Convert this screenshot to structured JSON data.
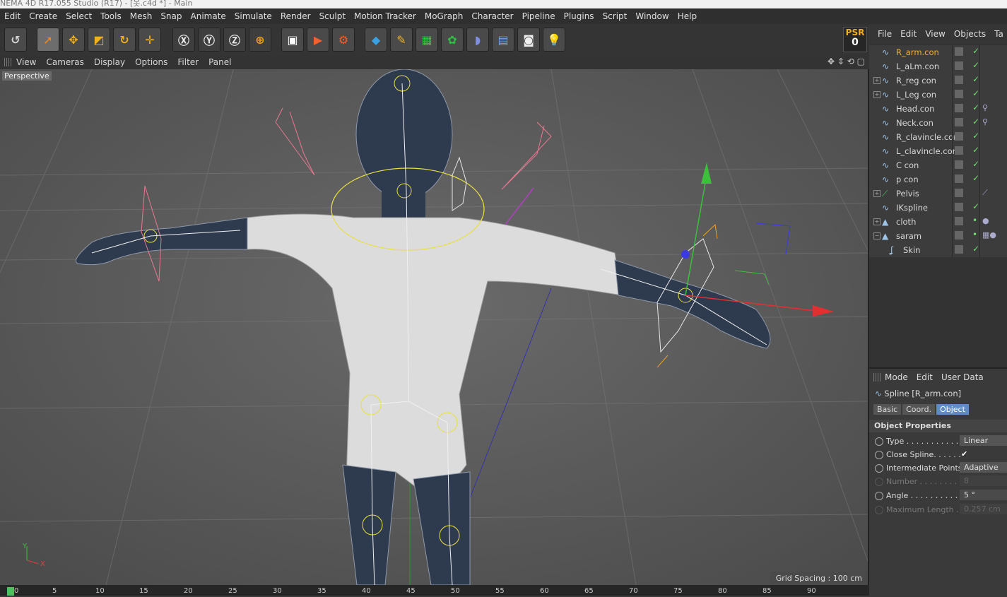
{
  "window": {
    "title": "NEMA 4D R17.055 Studio (R17) - [옷.c4d *] - Main"
  },
  "menu": [
    "Edit",
    "Create",
    "Select",
    "Tools",
    "Mesh",
    "Snap",
    "Animate",
    "Simulate",
    "Render",
    "Sculpt",
    "Motion Tracker",
    "MoGraph",
    "Character",
    "Pipeline",
    "Plugins",
    "Script",
    "Window",
    "Help"
  ],
  "psr": {
    "label": "PSR",
    "value": "0"
  },
  "viewport": {
    "menu": [
      "View",
      "Cameras",
      "Display",
      "Options",
      "Filter",
      "Panel"
    ],
    "label": "Perspective",
    "grid_spacing": "Grid Spacing : 100 cm",
    "axis_y": "Y",
    "axis_x": "X"
  },
  "timeline": {
    "ticks": [
      "0",
      "5",
      "10",
      "15",
      "20",
      "25",
      "30",
      "35",
      "40",
      "45",
      "50",
      "55",
      "60",
      "65",
      "70",
      "75",
      "80",
      "85",
      "90"
    ]
  },
  "objects_panel": {
    "menu": [
      "File",
      "Edit",
      "View",
      "Objects",
      "Ta"
    ],
    "items": [
      {
        "name": "R_arm.con",
        "highlight": true
      },
      {
        "name": "L_aLm.con"
      },
      {
        "name": "R_reg con",
        "expand": true
      },
      {
        "name": "L_Leg con",
        "expand": true
      },
      {
        "name": "Head.con"
      },
      {
        "name": "Neck.con"
      },
      {
        "name": "R_clavincle.con"
      },
      {
        "name": "L_clavincle.con"
      },
      {
        "name": "C con"
      },
      {
        "name": "p con"
      },
      {
        "name": "Pelvis",
        "expand": true
      },
      {
        "name": "IKspline"
      },
      {
        "name": "cloth",
        "expand": true
      },
      {
        "name": "saram",
        "expand": true
      },
      {
        "name": "Skin"
      }
    ]
  },
  "attributes": {
    "menu": [
      "Mode",
      "Edit",
      "User Data"
    ],
    "title": "Spline [R_arm.con]",
    "tabs": [
      "Basic",
      "Coord.",
      "Object"
    ],
    "section": "Object Properties",
    "props": [
      {
        "label": "Type . . . . . . . . . . .",
        "value": "Linear"
      },
      {
        "label": "Close Spline. . . . . .",
        "value": "✔"
      },
      {
        "label": "Intermediate Points",
        "value": "Adaptive"
      },
      {
        "label": "Number . . . . . . . . .",
        "value": "8"
      },
      {
        "label": "Angle . . . . . . . . . . .",
        "value": "5 °"
      },
      {
        "label": "Maximum Length .",
        "value": "0.257 cm"
      }
    ]
  },
  "colors": {
    "accent": "#f0b030",
    "tab_active": "#5f8cc4",
    "check": "#6fdc6f"
  }
}
